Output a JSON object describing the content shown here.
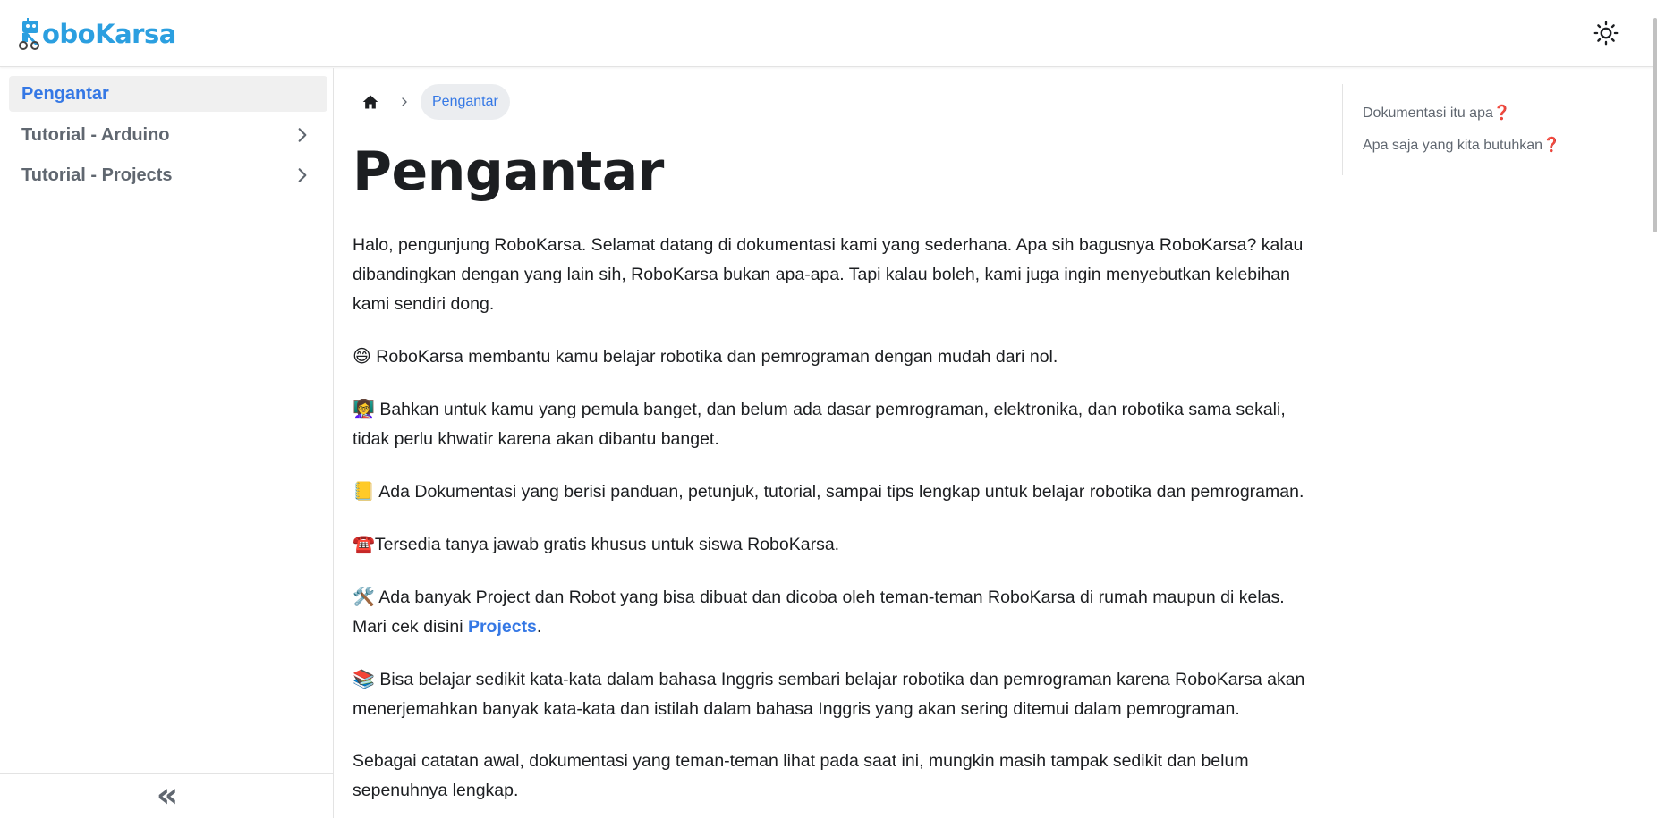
{
  "navbar": {
    "logo_text": "oboKarsa",
    "logo_letter": "R",
    "brand_color": "#2b9fe0",
    "theme_icon": "sun-icon"
  },
  "sidebar": {
    "items": [
      {
        "label": "Pengantar",
        "active": true
      },
      {
        "label": "Tutorial - Arduino",
        "active": false
      },
      {
        "label": "Tutorial - Projects",
        "active": false
      }
    ],
    "collapse_icon": "«"
  },
  "breadcrumb": {
    "home_icon": "home-icon",
    "current": "Pengantar"
  },
  "main": {
    "title": "Pengantar",
    "p1": "Halo, pengunjung RoboKarsa. Selamat datang di dokumentasi kami yang sederhana. Apa sih bagusnya RoboKarsa? kalau dibandingkan dengan yang lain sih, RoboKarsa bukan apa-apa. Tapi kalau boleh, kami juga ingin menyebutkan kelebihan kami sendiri dong.",
    "p2_emoji": "😄",
    "p2": " RoboKarsa membantu kamu belajar robotika dan pemrograman dengan mudah dari nol.",
    "p3_emoji": "👩‍🏫",
    "p3": " Bahkan untuk kamu yang pemula banget, dan belum ada dasar pemrograman, elektronika, dan robotika sama sekali, tidak perlu khwatir karena akan dibantu banget.",
    "p4_emoji": "📒",
    "p4": " Ada Dokumentasi yang berisi panduan, petunjuk, tutorial, sampai tips lengkap untuk belajar robotika dan pemrograman.",
    "p5_emoji": "☎️",
    "p5": "Tersedia tanya jawab gratis khusus untuk siswa RoboKarsa.",
    "p6_emoji": "🛠️",
    "p6_before": " Ada banyak Project dan Robot yang bisa dibuat dan dicoba oleh teman-teman RoboKarsa di rumah maupun di kelas. Mari cek disini ",
    "p6_link": "Projects",
    "p6_after": ".",
    "p7_emoji": "📚",
    "p7": " Bisa belajar sedikit kata-kata dalam bahasa Inggris sembari belajar robotika dan pemrograman karena RoboKarsa akan menerjemahkan banyak kata-kata dan istilah dalam bahasa Inggris yang akan sering ditemui dalam pemrograman.",
    "p8": "Sebagai catatan awal, dokumentasi yang teman-teman lihat pada saat ini, mungkin masih tampak sedikit dan belum sepenuhnya lengkap."
  },
  "toc": {
    "items": [
      {
        "label": "Dokumentasi itu apa",
        "mark": "❓"
      },
      {
        "label": "Apa saja yang kita butuhkan",
        "mark": "❓"
      }
    ]
  }
}
